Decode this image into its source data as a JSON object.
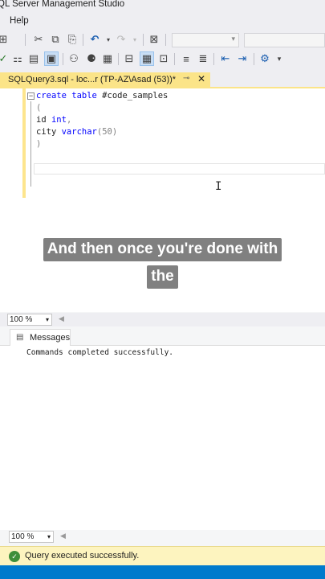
{
  "window": {
    "title": "QL Server Management Studio"
  },
  "menu": {
    "help_label": "Help"
  },
  "document_tab": {
    "label": "SQLQuery3.sql - loc...r (TP-AZ\\Asad (53))*",
    "pin": "⊸",
    "close": "✕"
  },
  "editor": {
    "lines": {
      "l1_kw": "create table",
      "l1_rest": " #code_samples",
      "l2": "(",
      "l3_name": "id ",
      "l3_type": "int",
      "l3_rest": ",",
      "l4_name": "city ",
      "l4_type": "varchar",
      "l4_paren": "(50)",
      "l5": ")"
    }
  },
  "caption": {
    "line1": "And then once you're done with",
    "line2": "the"
  },
  "zoom": {
    "editor_value": "100 %",
    "results_value": "100 %"
  },
  "results": {
    "messages_tab_label": "Messages",
    "message_text": "Commands completed successfully."
  },
  "status": {
    "text": "Query executed successfully.",
    "color": "#fdf4bf"
  },
  "colors": {
    "keyword": "#0000ff",
    "accent": "#007acc",
    "tab_active": "#fbe488"
  }
}
